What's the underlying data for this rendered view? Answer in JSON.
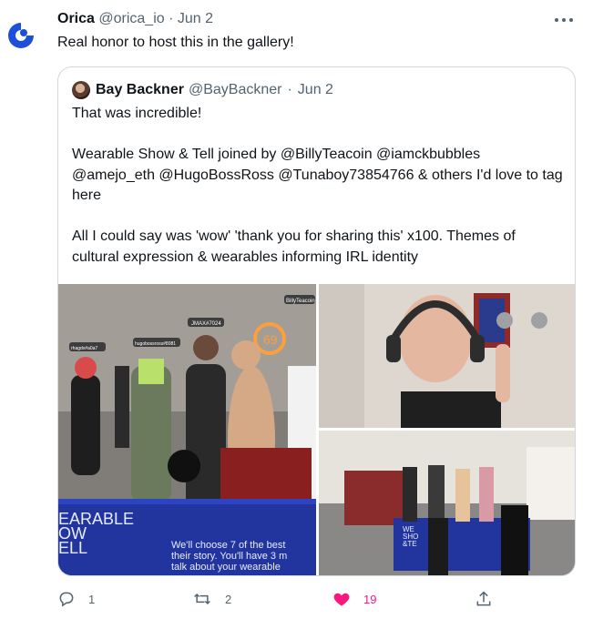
{
  "tweet": {
    "author_name": "Orica",
    "author_handle": "@orica_io",
    "date": "Jun 2",
    "text": "Real honor to host this in the gallery!",
    "more_icon": "more-horizontal-icon"
  },
  "quote": {
    "author_name": "Bay Backner",
    "author_handle": "@BayBackner",
    "date": "Jun 2",
    "paragraphs": [
      "That was incredible!",
      "Wearable Show & Tell joined by @BillyTeacoin @iamckbubbles @amejo_eth @HugoBossRoss @Tunaboy73854766 & others I'd love to tag here",
      "All I could say was 'wow' 'thank you for sharing this' x100. Themes of cultural expression & wearables informing IRL identity"
    ]
  },
  "media": {
    "image_a": {
      "name_tags": [
        "BillyTeacoin",
        "JMAX#7024",
        "hugobossross#8081",
        "rhagdv#a0a7"
      ],
      "banner_title": "EARABLE\nOW\nELL",
      "banner_text": "We'll choose 7 of the best\ntheir story. You'll have 3 m\ntalk about your wearable"
    },
    "image_c": {
      "banner_title": "WE\nSHO\n&TE"
    }
  },
  "actions": {
    "reply_count": "1",
    "retweet_count": "2",
    "like_count": "19",
    "like_color": "#f91880"
  },
  "colors": {
    "text": "#0f1419",
    "muted": "#536471",
    "border": "#cfd9de",
    "brand": "#1d4fd8"
  }
}
